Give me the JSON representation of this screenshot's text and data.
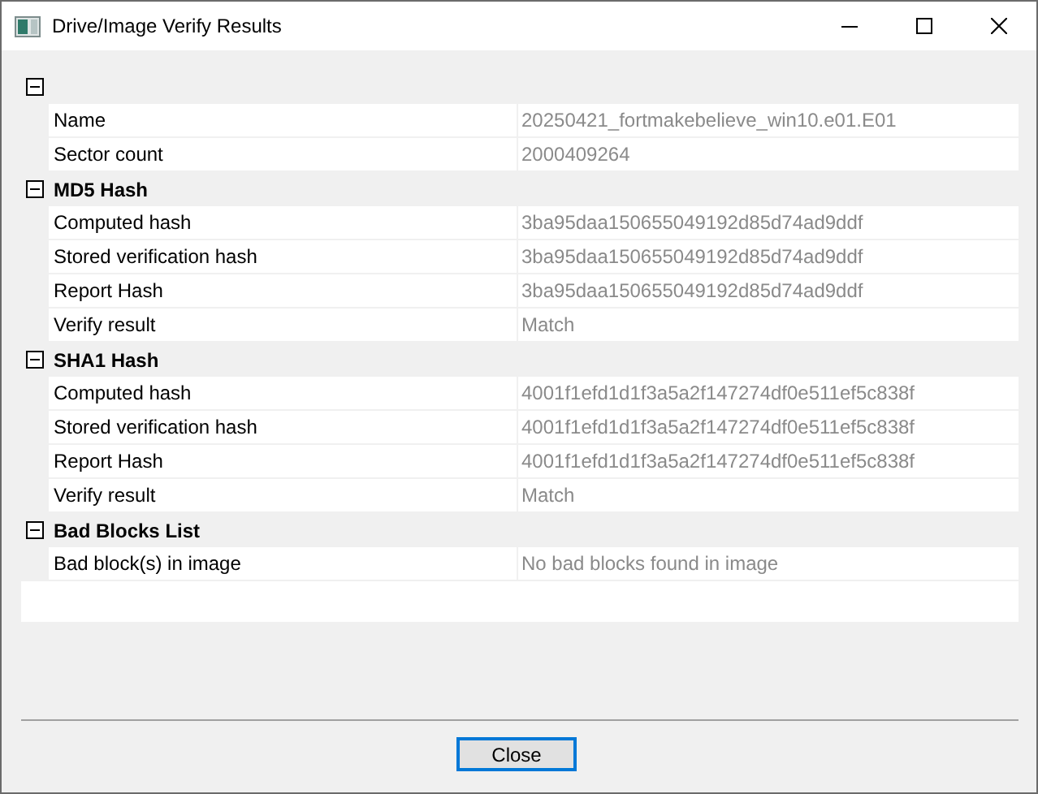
{
  "window": {
    "title": "Drive/Image Verify Results"
  },
  "categories": [
    {
      "expanded": true,
      "properties": [
        {
          "label": "Name",
          "value": "20250421_fortmakebelieve_win10.e01.E01"
        },
        {
          "label": "Sector count",
          "value": "2000409264"
        }
      ]
    },
    {
      "name": "MD5 Hash",
      "expanded": true,
      "properties": [
        {
          "label": "Computed hash",
          "value": "3ba95daa150655049192d85d74ad9ddf"
        },
        {
          "label": "Stored verification hash",
          "value": "3ba95daa150655049192d85d74ad9ddf"
        },
        {
          "label": "Report Hash",
          "value": "3ba95daa150655049192d85d74ad9ddf"
        },
        {
          "label": "Verify result",
          "value": "Match"
        }
      ]
    },
    {
      "name": "SHA1 Hash",
      "expanded": true,
      "properties": [
        {
          "label": "Computed hash",
          "value": "4001f1efd1d1f3a5a2f147274df0e511ef5c838f"
        },
        {
          "label": "Stored verification hash",
          "value": "4001f1efd1d1f3a5a2f147274df0e511ef5c838f"
        },
        {
          "label": "Report Hash",
          "value": "4001f1efd1d1f3a5a2f147274df0e511ef5c838f"
        },
        {
          "label": "Verify result",
          "value": "Match"
        }
      ]
    },
    {
      "name": "Bad Blocks List",
      "expanded": true,
      "properties": [
        {
          "label": "Bad block(s) in image",
          "value": "No bad blocks found in image"
        }
      ]
    }
  ],
  "buttons": [
    {
      "label": "Close"
    }
  ]
}
